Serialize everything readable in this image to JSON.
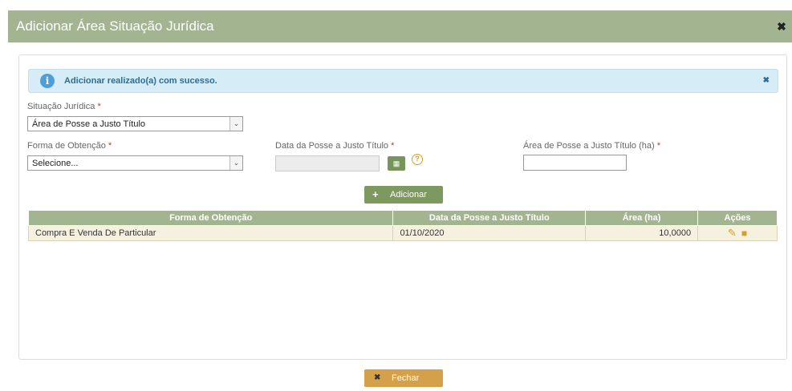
{
  "dialog": {
    "title": "Adicionar Área Situação Jurídica",
    "close_glyph": "✖"
  },
  "alert": {
    "icon": "info-icon",
    "icon_glyph": "i",
    "message": "Adicionar realizado(a) com sucesso.",
    "close_glyph": "✖"
  },
  "form": {
    "situacao_label": "Situação Jurídica",
    "situacao_value": "Área de Posse a Justo Título",
    "forma_label": "Forma de Obtenção",
    "forma_value": "Selecione...",
    "data_label": "Data da Posse a Justo Título",
    "data_value": "",
    "area_label": "Área de Posse a Justo Título (ha)",
    "area_value": "",
    "required_mark": "*",
    "help_glyph": "?"
  },
  "add_button": {
    "icon_glyph": "+",
    "label": "Adicionar"
  },
  "table": {
    "headers": [
      "Forma de Obtenção",
      "Data da Posse a Justo Título",
      "Área (ha)",
      "Ações"
    ],
    "rows": [
      {
        "forma": "Compra E Venda De Particular",
        "data": "01/10/2020",
        "area": "10,0000"
      }
    ]
  },
  "close_button": {
    "icon_glyph": "✖",
    "label": "Fechar"
  },
  "colors": {
    "header_green": "#a3b590",
    "button_green": "#7d9960",
    "button_orange": "#d4a14a",
    "alert_blue": "#d6ecf6",
    "row_beige": "#f6f1df"
  }
}
